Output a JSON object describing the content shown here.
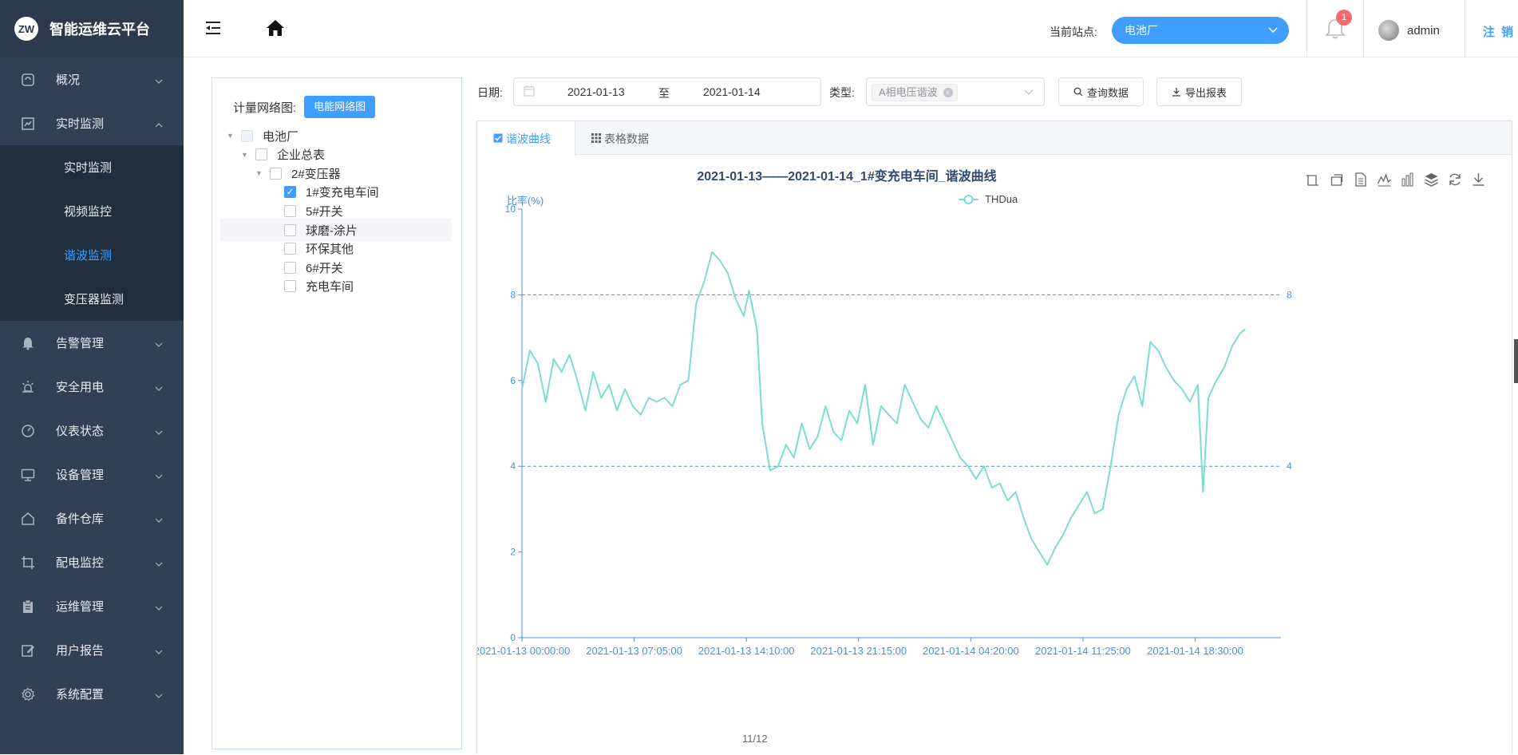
{
  "app": {
    "logo_text": "ZW",
    "title": "智能运维云平台"
  },
  "sidebar": {
    "items": [
      {
        "label": "概况",
        "icon": "dashboard-icon"
      },
      {
        "label": "实时监测",
        "icon": "chart-icon",
        "expanded": true,
        "children": [
          {
            "label": "实时监测"
          },
          {
            "label": "视频监控"
          },
          {
            "label": "谐波监测",
            "active": true
          },
          {
            "label": "变压器监测"
          }
        ]
      },
      {
        "label": "告警管理",
        "icon": "bell-icon"
      },
      {
        "label": "安全用电",
        "icon": "alarm-light-icon"
      },
      {
        "label": "仪表状态",
        "icon": "gauge-icon"
      },
      {
        "label": "设备管理",
        "icon": "monitor-icon"
      },
      {
        "label": "备件仓库",
        "icon": "home-icon"
      },
      {
        "label": "配电监控",
        "icon": "crop-icon"
      },
      {
        "label": "运维管理",
        "icon": "clipboard-icon"
      },
      {
        "label": "用户报告",
        "icon": "edit-icon"
      },
      {
        "label": "系统配置",
        "icon": "gear-icon"
      }
    ]
  },
  "header": {
    "station_label": "当前站点:",
    "station_value": "电池厂",
    "notification_count": "1",
    "username": "admin",
    "logout_label": "注 销"
  },
  "tree": {
    "label": "计量网络图:",
    "button": "电能网络图",
    "nodes": [
      {
        "label": "电池厂",
        "level": 0,
        "state": "partial",
        "caret": true
      },
      {
        "label": "企业总表",
        "level": 1,
        "state": "none",
        "caret": true
      },
      {
        "label": "2#变压器",
        "level": 2,
        "state": "none",
        "caret": true
      },
      {
        "label": "1#变充电车间",
        "level": 3,
        "state": "checked"
      },
      {
        "label": "5#开关",
        "level": 3,
        "state": "none"
      },
      {
        "label": "球磨-涂片",
        "level": 3,
        "state": "none",
        "hover": true
      },
      {
        "label": "环保其他",
        "level": 3,
        "state": "none"
      },
      {
        "label": "6#开关",
        "level": 3,
        "state": "none"
      },
      {
        "label": "充电车间",
        "level": 3,
        "state": "none"
      }
    ]
  },
  "filters": {
    "date_label": "日期:",
    "date_start": "2021-01-13",
    "date_sep": "至",
    "date_end": "2021-01-14",
    "type_label": "类型:",
    "type_tag": "A相电压谐波",
    "query_button": "查询数据",
    "export_button": "导出报表"
  },
  "tabs": [
    {
      "label": "谐波曲线",
      "active": true
    },
    {
      "label": "表格数据",
      "active": false
    }
  ],
  "toolbox_icons": [
    "zoom-icon",
    "zoom-reset-icon",
    "data-view-icon",
    "line-type-icon",
    "bar-type-icon",
    "stack-icon",
    "restore-icon",
    "download-icon"
  ],
  "pager": "11/12",
  "colors": {
    "accent": "#409eff",
    "sidebar": "#304156",
    "line": "#7ddbd5",
    "axis": "#4a90e2"
  },
  "chart_data": {
    "type": "line",
    "title": "2021-01-13——2021-01-14_1#变充电车间_谐波曲线",
    "ylabel": "比率(%)",
    "xlabel": "",
    "legend": "THDua",
    "legend_position": "top-center",
    "ylim": [
      0,
      10
    ],
    "yticks": [
      "0",
      "2",
      "4",
      "6",
      "8",
      "10"
    ],
    "mark_lines": [
      8,
      4
    ],
    "mark_line_labels": [
      "8",
      "4"
    ],
    "xticks": [
      "2021-01-13 00:00:00",
      "2021-01-13 07:05:00",
      "2021-01-13 14:10:00",
      "2021-01-13 21:15:00",
      "2021-01-14 04:20:00",
      "2021-01-14 11:25:00",
      "2021-01-14 18:30:00"
    ],
    "x_range": [
      "2021-01-13 00:00",
      "2021-01-14 23:55"
    ],
    "series": [
      {
        "name": "THDua",
        "points": [
          [
            "2021-01-13 00:00",
            5.8
          ],
          [
            "2021-01-13 00:30",
            6.7
          ],
          [
            "2021-01-13 01:00",
            6.4
          ],
          [
            "2021-01-13 01:30",
            5.5
          ],
          [
            "2021-01-13 02:00",
            6.5
          ],
          [
            "2021-01-13 02:30",
            6.2
          ],
          [
            "2021-01-13 03:00",
            6.6
          ],
          [
            "2021-01-13 03:30",
            6.0
          ],
          [
            "2021-01-13 04:00",
            5.3
          ],
          [
            "2021-01-13 04:30",
            6.2
          ],
          [
            "2021-01-13 05:00",
            5.6
          ],
          [
            "2021-01-13 05:30",
            5.9
          ],
          [
            "2021-01-13 06:00",
            5.3
          ],
          [
            "2021-01-13 06:30",
            5.8
          ],
          [
            "2021-01-13 07:00",
            5.4
          ],
          [
            "2021-01-13 07:30",
            5.2
          ],
          [
            "2021-01-13 08:00",
            5.6
          ],
          [
            "2021-01-13 08:30",
            5.5
          ],
          [
            "2021-01-13 09:00",
            5.6
          ],
          [
            "2021-01-13 09:30",
            5.4
          ],
          [
            "2021-01-13 10:00",
            5.9
          ],
          [
            "2021-01-13 10:30",
            6.0
          ],
          [
            "2021-01-13 11:00",
            7.8
          ],
          [
            "2021-01-13 11:30",
            8.3
          ],
          [
            "2021-01-13 12:00",
            9.0
          ],
          [
            "2021-01-13 12:30",
            8.8
          ],
          [
            "2021-01-13 13:00",
            8.5
          ],
          [
            "2021-01-13 13:30",
            7.9
          ],
          [
            "2021-01-13 14:00",
            7.5
          ],
          [
            "2021-01-13 14:20",
            8.1
          ],
          [
            "2021-01-13 14:50",
            7.2
          ],
          [
            "2021-01-13 15:10",
            5.0
          ],
          [
            "2021-01-13 15:40",
            3.9
          ],
          [
            "2021-01-13 16:10",
            4.0
          ],
          [
            "2021-01-13 16:40",
            4.5
          ],
          [
            "2021-01-13 17:10",
            4.2
          ],
          [
            "2021-01-13 17:40",
            5.0
          ],
          [
            "2021-01-13 18:10",
            4.4
          ],
          [
            "2021-01-13 18:40",
            4.7
          ],
          [
            "2021-01-13 19:10",
            5.4
          ],
          [
            "2021-01-13 19:40",
            4.8
          ],
          [
            "2021-01-13 20:10",
            4.6
          ],
          [
            "2021-01-13 20:40",
            5.3
          ],
          [
            "2021-01-13 21:10",
            5.0
          ],
          [
            "2021-01-13 21:40",
            5.9
          ],
          [
            "2021-01-13 22:10",
            4.5
          ],
          [
            "2021-01-13 22:40",
            5.4
          ],
          [
            "2021-01-13 23:10",
            5.2
          ],
          [
            "2021-01-13 23:40",
            5.0
          ],
          [
            "2021-01-14 00:10",
            5.9
          ],
          [
            "2021-01-14 00:40",
            5.5
          ],
          [
            "2021-01-14 01:10",
            5.1
          ],
          [
            "2021-01-14 01:40",
            4.9
          ],
          [
            "2021-01-14 02:10",
            5.4
          ],
          [
            "2021-01-14 02:40",
            5.0
          ],
          [
            "2021-01-14 03:10",
            4.6
          ],
          [
            "2021-01-14 03:40",
            4.2
          ],
          [
            "2021-01-14 04:10",
            4.0
          ],
          [
            "2021-01-14 04:40",
            3.7
          ],
          [
            "2021-01-14 05:10",
            4.0
          ],
          [
            "2021-01-14 05:40",
            3.5
          ],
          [
            "2021-01-14 06:10",
            3.6
          ],
          [
            "2021-01-14 06:40",
            3.2
          ],
          [
            "2021-01-14 07:10",
            3.4
          ],
          [
            "2021-01-14 07:40",
            2.8
          ],
          [
            "2021-01-14 08:10",
            2.3
          ],
          [
            "2021-01-14 08:40",
            2.0
          ],
          [
            "2021-01-14 09:10",
            1.7
          ],
          [
            "2021-01-14 09:40",
            2.1
          ],
          [
            "2021-01-14 10:10",
            2.4
          ],
          [
            "2021-01-14 10:40",
            2.8
          ],
          [
            "2021-01-14 11:10",
            3.1
          ],
          [
            "2021-01-14 11:40",
            3.4
          ],
          [
            "2021-01-14 12:10",
            2.9
          ],
          [
            "2021-01-14 12:40",
            3.0
          ],
          [
            "2021-01-14 13:10",
            4.0
          ],
          [
            "2021-01-14 13:40",
            5.2
          ],
          [
            "2021-01-14 14:10",
            5.8
          ],
          [
            "2021-01-14 14:40",
            6.1
          ],
          [
            "2021-01-14 15:10",
            5.4
          ],
          [
            "2021-01-14 15:40",
            6.9
          ],
          [
            "2021-01-14 16:10",
            6.7
          ],
          [
            "2021-01-14 16:40",
            6.3
          ],
          [
            "2021-01-14 17:10",
            6.0
          ],
          [
            "2021-01-14 17:40",
            5.8
          ],
          [
            "2021-01-14 18:10",
            5.5
          ],
          [
            "2021-01-14 18:40",
            5.9
          ],
          [
            "2021-01-14 19:00",
            3.4
          ],
          [
            "2021-01-14 19:20",
            5.6
          ],
          [
            "2021-01-14 19:50",
            6.0
          ],
          [
            "2021-01-14 20:20",
            6.3
          ],
          [
            "2021-01-14 20:50",
            6.8
          ],
          [
            "2021-01-14 21:20",
            7.1
          ],
          [
            "2021-01-14 21:40",
            7.2
          ]
        ]
      }
    ],
    "grid": false
  }
}
